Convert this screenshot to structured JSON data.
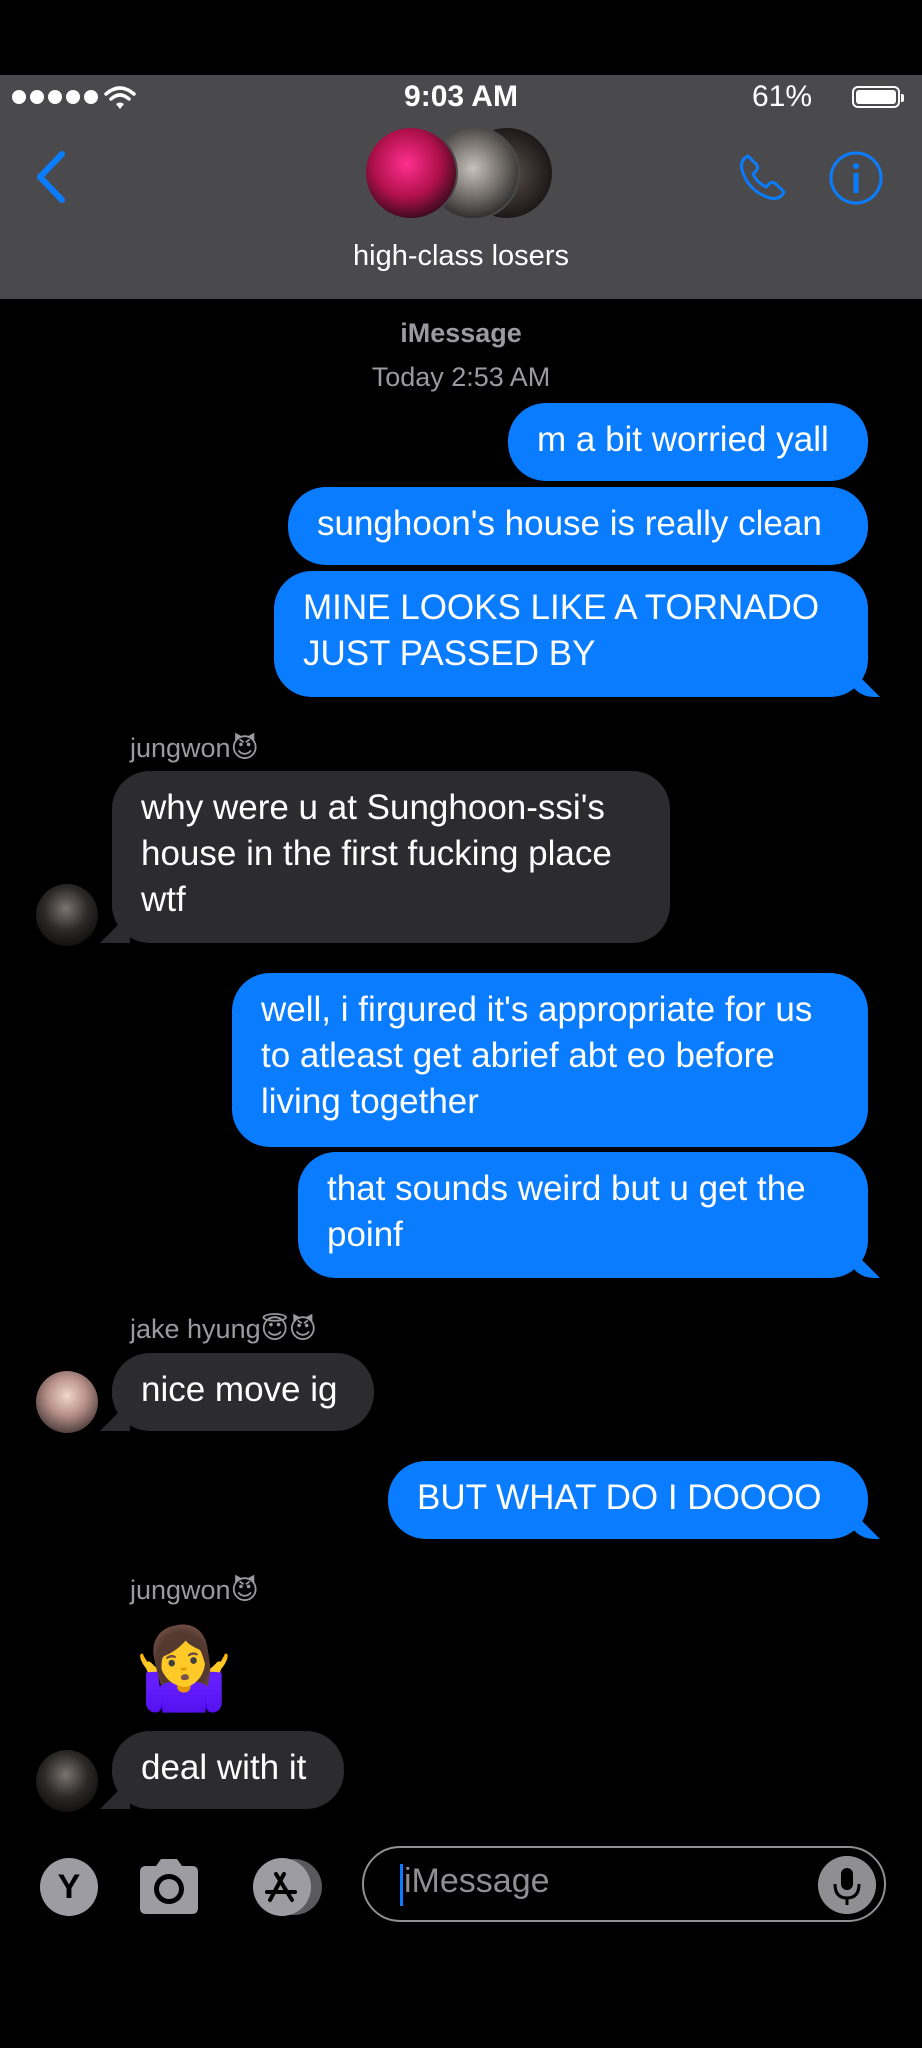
{
  "status_bar": {
    "time": "9:03 AM",
    "battery_pct": "61%",
    "battery_level": 0.61
  },
  "header": {
    "group_name": "high-class losers"
  },
  "conversation": {
    "service": "iMessage",
    "timestamp": "Today 2:53 AM"
  },
  "messages": {
    "m1": "m a bit worried yall",
    "m2": "sunghoon's house is really clean",
    "m3": "MINE LOOKS LIKE A TORNADO\nJUST PASSED BY",
    "s1": "jungwon😈",
    "m4": "why were u at Sunghoon-ssi's\nhouse in the first fucking place\nwtf",
    "m5": "well, i firgured it's appropriate for us\nto atleast get abrief abt eo before\nliving together",
    "m6": "that sounds weird but u get the\npoinf",
    "s2": "jake hyung😇😈",
    "m7": "nice move ig",
    "m8": "BUT WHAT DO I DOOOO",
    "s3": "jungwon😈",
    "m9": "🤷‍♀️",
    "m10": "deal with it"
  },
  "compose": {
    "placeholder": "iMessage",
    "app_button_label": "Y"
  },
  "colors": {
    "outgoing_bubble": "#0a7cff",
    "incoming_bubble": "#2c2c2e",
    "header_bg": "#4a4a4c",
    "accent": "#0a7cff"
  },
  "icons": [
    "signal-dots-icon",
    "wifi-icon",
    "battery-icon",
    "back-chevron-icon",
    "phone-icon",
    "info-icon",
    "camera-icon",
    "app-store-icon",
    "microphone-icon"
  ]
}
